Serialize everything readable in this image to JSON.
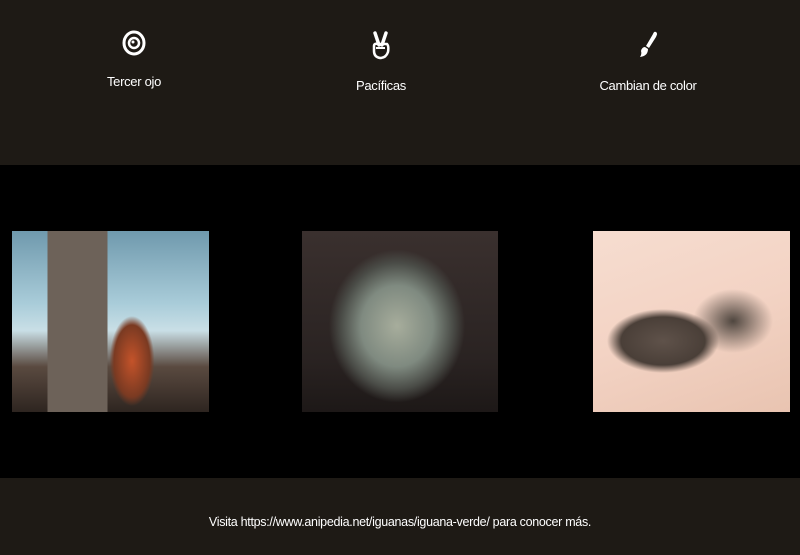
{
  "features": [
    {
      "icon": "eye-icon",
      "label": "Tercer ojo"
    },
    {
      "icon": "peace-hand-icon",
      "label": "Pacíficas"
    },
    {
      "icon": "paintbrush-icon",
      "label": "Cambian de color"
    }
  ],
  "gallery": [
    {
      "name": "orange-iguana-photo"
    },
    {
      "name": "iguana-head-photo"
    },
    {
      "name": "iguanas-on-sand-photo"
    }
  ],
  "footer": {
    "text": "Visita https://www.anipedia.net/iguanas/iguana-verde/ para conocer más."
  },
  "colors": {
    "band": "#1e1a15",
    "middle": "#000000",
    "text": "#ffffff"
  }
}
